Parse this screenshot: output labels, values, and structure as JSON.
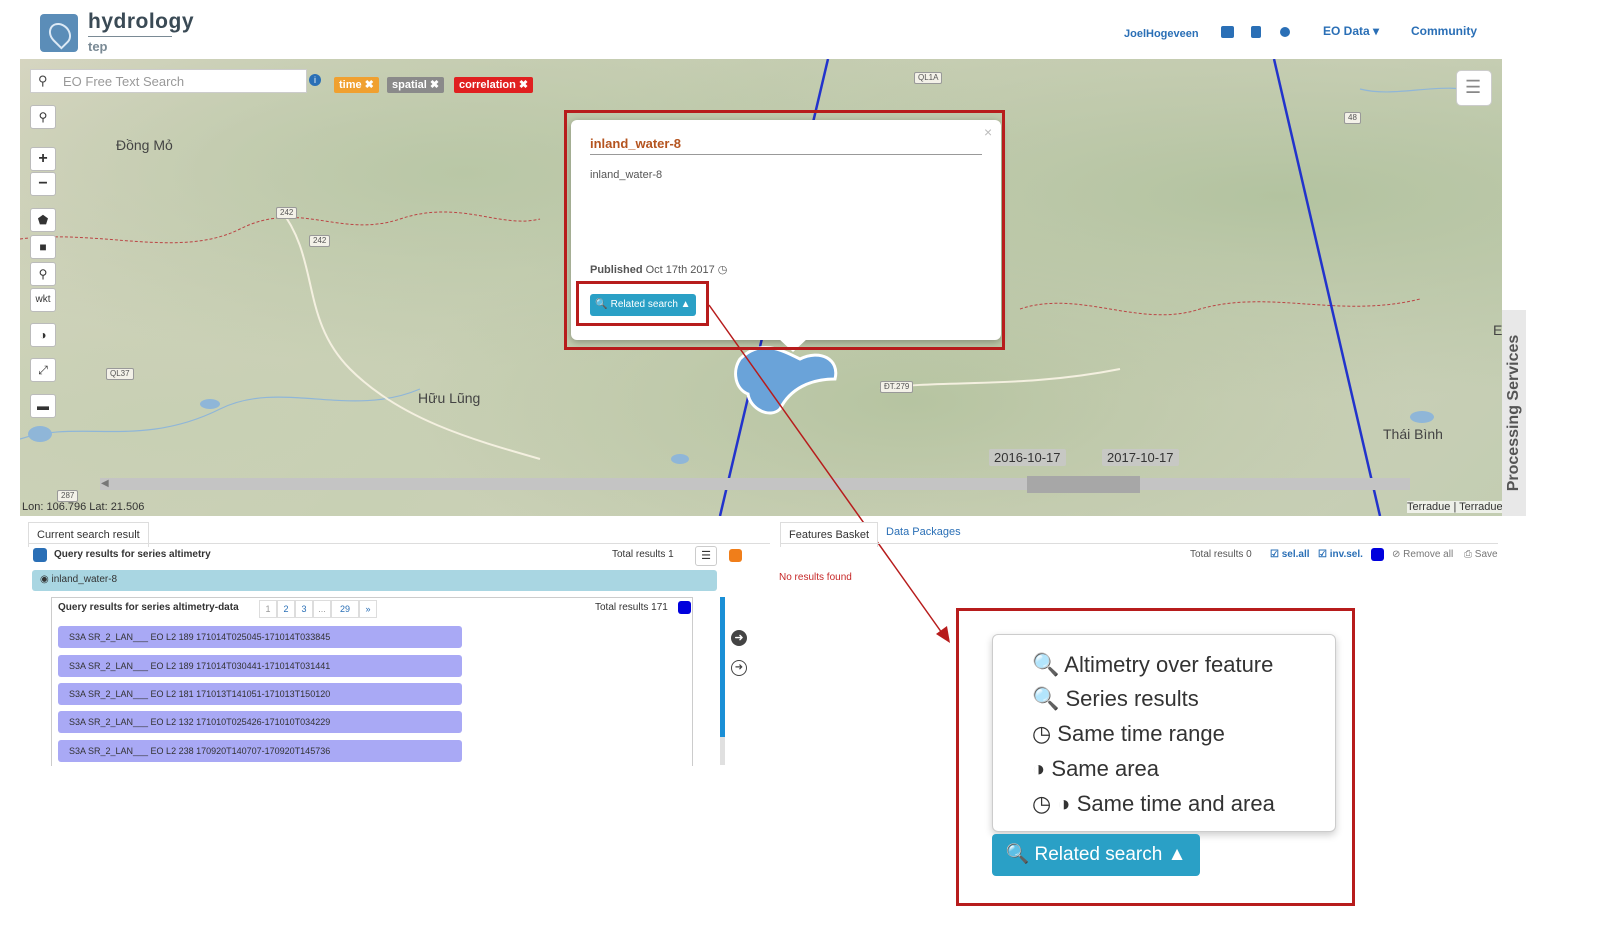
{
  "header": {
    "brand": "hydrology",
    "brand_sub": "tep",
    "user": "JoelHogeveen",
    "nav": [
      {
        "label": "EO Data ▾"
      },
      {
        "label": "Community"
      }
    ]
  },
  "search": {
    "placeholder": "EO Free Text Search",
    "tags": [
      {
        "label": "time ✖",
        "color": "#f0a030"
      },
      {
        "label": "spatial ✖",
        "color": "#8a8a8a"
      },
      {
        "label": "correlation ✖",
        "color": "#e02020"
      }
    ]
  },
  "map": {
    "places": [
      "Đồng Mỏ",
      "Hữu Lũng",
      "Thái Bình",
      "E"
    ],
    "roads": [
      "QL1A",
      "48",
      "242",
      "242",
      "QL37",
      "ĐT.279",
      "287"
    ],
    "coord": "Lon: 106.796 Lat: 21.506",
    "attribution": "Terradue | Terradue",
    "timeline": {
      "start": "2016-10-17",
      "end": "2017-10-17"
    },
    "tools": [
      "wkt"
    ]
  },
  "popup": {
    "title": "inland_water-8",
    "desc": "inland_water-8",
    "published_label": "Published",
    "published_date": "Oct 17th 2017 ◷",
    "related_label": "🔍 Related search ▲",
    "close": "×"
  },
  "side_tab": "Processing Services",
  "left_panel": {
    "tab": "Current search result",
    "query_title": "Query results for series altimetry",
    "total": "Total results  1",
    "feature": "◉ inland_water-8",
    "sub_title": "Query results for series altimetry-data",
    "pages": [
      "1",
      "2",
      "3",
      "...",
      "29",
      "»"
    ],
    "sub_total": "Total results  171",
    "rows": [
      "S3A SR_2_LAN___ EO L2 189 171014T025045-171014T033845",
      "S3A SR_2_LAN___ EO L2 189 171014T030441-171014T031441",
      "S3A SR_2_LAN___ EO L2 181 171013T141051-171013T150120",
      "S3A SR_2_LAN___ EO L2 132 171010T025426-171010T034229",
      "S3A SR_2_LAN___ EO L2 238 170920T140707-170920T145736"
    ]
  },
  "right_panel": {
    "tabs": [
      "Features Basket",
      "Data Packages"
    ],
    "total": "Total results  0",
    "sel_all": "☑ sel.all",
    "inv_sel": "☑ inv.sel.",
    "remove_all": "⊘ Remove all",
    "save": "⎙ Save",
    "empty": "No results found"
  },
  "zoom_dropdown": {
    "items": [
      "🔍 Altimetry over feature",
      "🔍 Series results",
      "◷ Same time range",
      "◑ Same area",
      "◷ ◑ Same time and area"
    ],
    "button": "🔍 Related search ▲"
  }
}
